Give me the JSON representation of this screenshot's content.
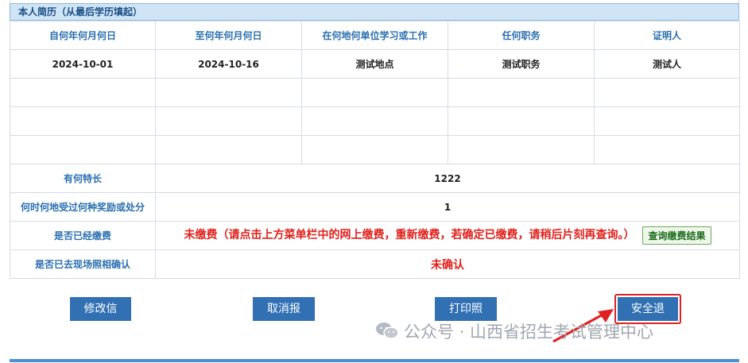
{
  "section": {
    "title": "本人简历（从最后学历填起）"
  },
  "table": {
    "headers": [
      "自何年何月何日",
      "至何年何月何日",
      "在何地何单位学习或工作",
      "任何职务",
      "证明人"
    ],
    "rows": [
      [
        "2024-10-01",
        "2024-10-16",
        "测试地点",
        "测试职务",
        "测试人"
      ],
      [
        "",
        "",
        "",
        "",
        ""
      ],
      [
        "",
        "",
        "",
        "",
        ""
      ],
      [
        "",
        "",
        "",
        "",
        ""
      ]
    ]
  },
  "info": {
    "specialty_label": "有何特长",
    "specialty_value": "1222",
    "awards_label": "何时何地受过何种奖励或处分",
    "awards_value": "1",
    "payment_label": "是否已经缴费",
    "payment_value": "未缴费（请点击上方菜单栏中的网上缴费，重新缴费，若确定已缴费，请稍后片刻再查询。）",
    "payment_query_button": "查询缴费结果",
    "photo_label": "是否已去现场照相确认",
    "photo_value": "未确认"
  },
  "actions": {
    "edit": "修改信息",
    "cancel": "取消报名",
    "print": "打印照片",
    "exit": "安全退出"
  },
  "watermark": {
    "text": "公众号 · 山西省招生考试管理中心"
  },
  "colors": {
    "accent_blue": "#3170b3",
    "alert_red": "#e0201b",
    "header_bg": "#cfe4f5"
  }
}
